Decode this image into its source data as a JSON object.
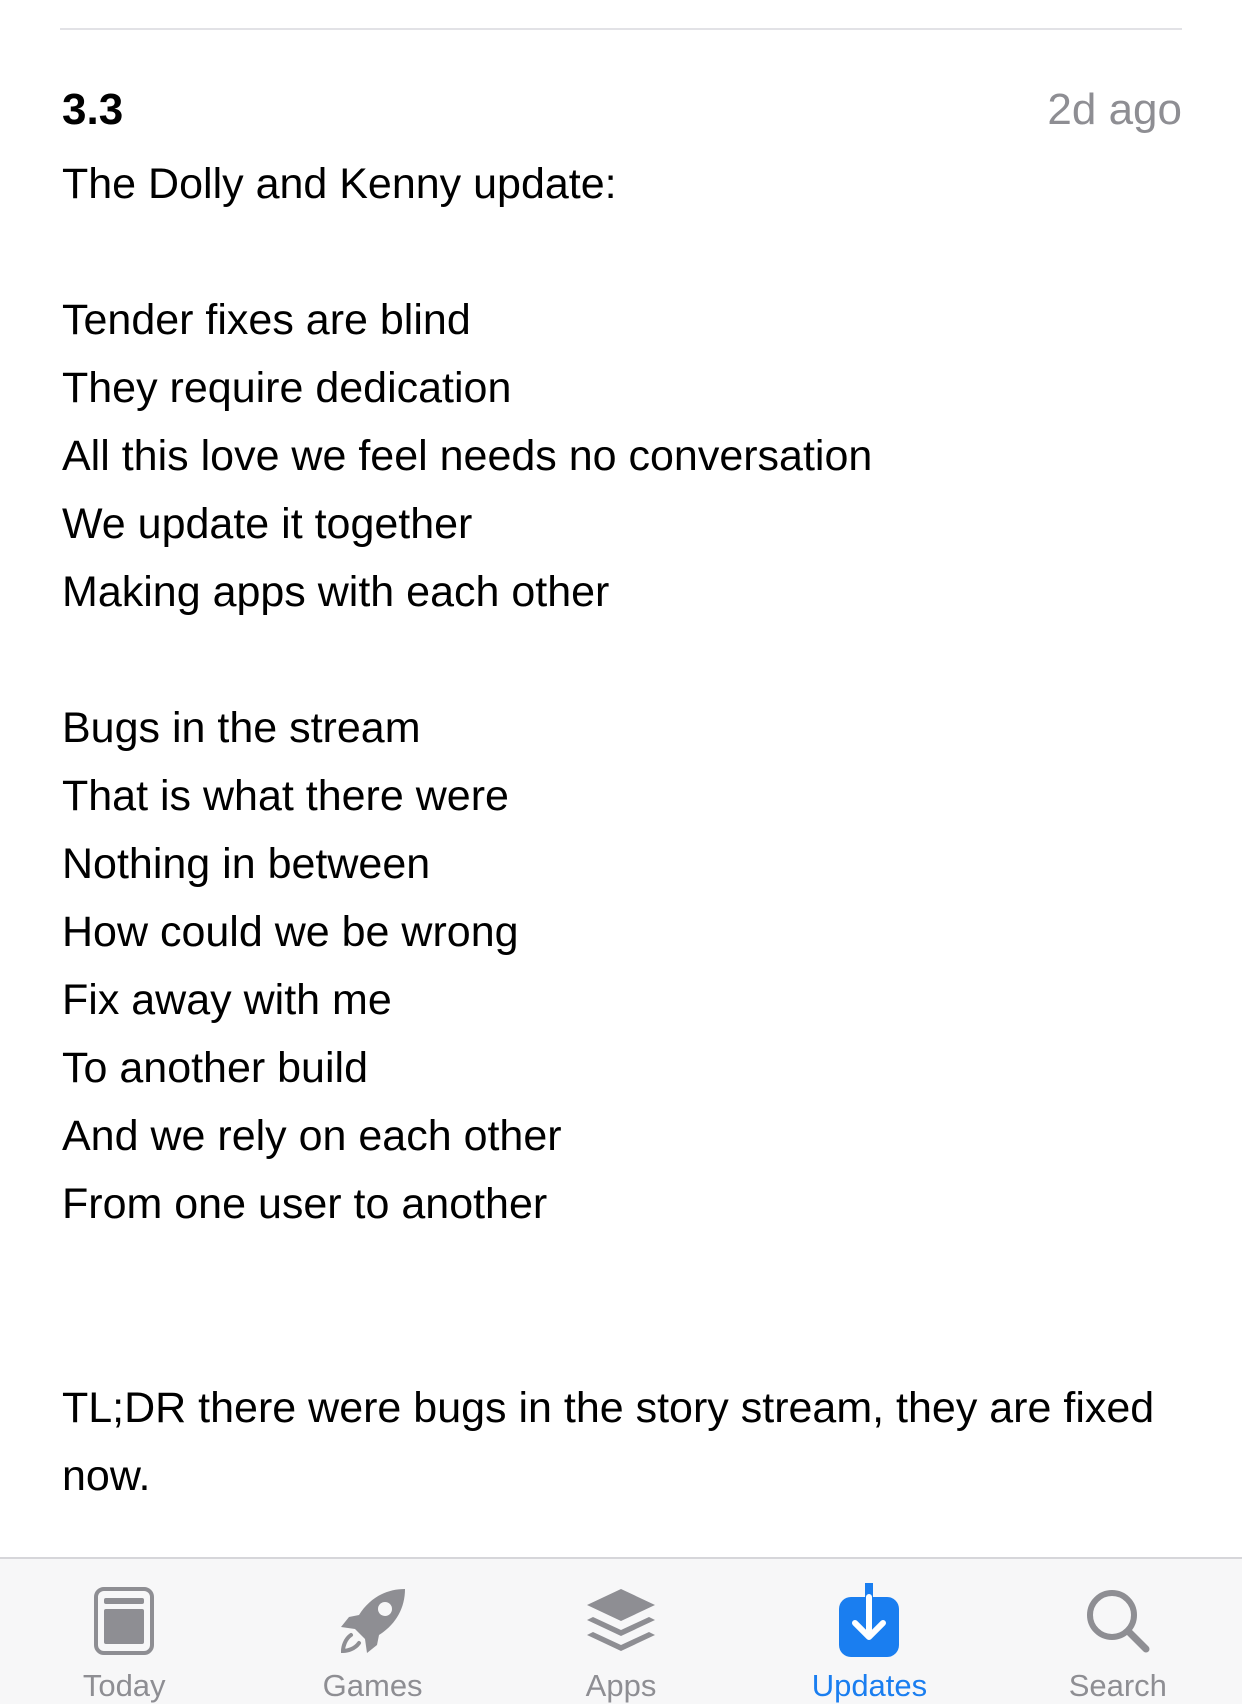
{
  "release": {
    "version": "3.3",
    "date": "2d ago"
  },
  "notes": {
    "title": "The Dolly and Kenny update:",
    "verse1": [
      "Tender fixes are blind",
      "They require dedication",
      "All this love we feel needs no conversation",
      "We update it together",
      "Making apps with each other"
    ],
    "verse2": [
      "Bugs in the stream",
      "That is what there were",
      "Nothing in between",
      "How could we be wrong",
      "Fix away with me",
      "To another build",
      "And we rely on each other",
      "From one user to another"
    ],
    "tldr": "TL;DR there were bugs in the story stream, they are fixed now."
  },
  "tabbar": {
    "active": "Updates",
    "colors": {
      "active": "#1a7ef0",
      "inactive": "#8e8e93"
    },
    "tabs": [
      {
        "label": "Today",
        "icon": "today-icon"
      },
      {
        "label": "Games",
        "icon": "rocket-icon"
      },
      {
        "label": "Apps",
        "icon": "layers-icon"
      },
      {
        "label": "Updates",
        "icon": "download-icon"
      },
      {
        "label": "Search",
        "icon": "search-icon"
      }
    ]
  }
}
